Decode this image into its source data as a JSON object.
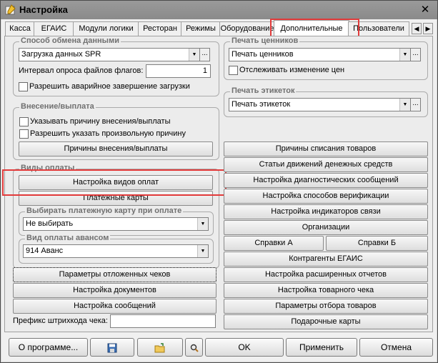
{
  "window": {
    "title": "Настройка",
    "close_glyph": "✕"
  },
  "tabs": [
    "Касса",
    "ЕГАИС",
    "Модули логики",
    "Ресторан",
    "Режимы",
    "Оборудование",
    "Дополнительные",
    "Пользователи"
  ],
  "tab_scroll": {
    "left": "◀",
    "right": "▶"
  },
  "exchange": {
    "legend": "Способ обмена данными",
    "mode_value": "Загрузка данных SPR",
    "interval_label": "Интервал опроса файлов флагов:",
    "interval_value": "1",
    "emergency_label": "Разрешить аварийное завершение загрузки"
  },
  "deposit": {
    "legend": "Внесение/выплата",
    "reason_label": "Указывать причину внесения/выплаты",
    "arbitrary_label": "Разрешить указать произвольную причину",
    "reasons_button": "Причины внесения/выплаты"
  },
  "payment_types": {
    "legend": "Виды оплаты",
    "setup_button": "Настройка видов оплат",
    "cards_button": "Платежные карты"
  },
  "select_card": {
    "legend": "Выбирать платежную карту при оплате",
    "value": "Не выбирать"
  },
  "advance": {
    "legend": "Вид оплаты авансом",
    "value": "914 Аванс"
  },
  "left_buttons": [
    "Параметры отложенных чеков",
    "Настройка документов",
    "Настройка сообщений"
  ],
  "barcode": {
    "label": "Префикс штрихкода чека:",
    "value": ""
  },
  "price_tags": {
    "legend": "Печать ценников",
    "value": "Печать ценников",
    "track_label": "Отслеживать изменение цен"
  },
  "labels_print": {
    "legend": "Печать этикеток",
    "value": "Печать этикеток"
  },
  "right_buttons": {
    "write_off": "Причины списания товаров",
    "cash_flow": "Статьи движений денежных средств",
    "diagnostics": "Настройка диагностических сообщений",
    "verification": "Настройка способов верификации",
    "connection": "Настройка индикаторов связи",
    "organizations": "Организации",
    "ref_a": "Справки А",
    "ref_b": "Справки Б",
    "egais_partners": "Контрагенты ЕГАИС",
    "ext_reports": "Настройка расширенных отчетов",
    "goods_check": "Настройка товарного чека",
    "goods_filter": "Параметры отбора товаров",
    "gift_cards": "Подарочные карты"
  },
  "ellipsis": "...",
  "bottom": {
    "about": "О программе...",
    "ok": "OK",
    "apply": "Применить",
    "cancel": "Отмена"
  },
  "colors": {
    "highlight": "#e23b3b",
    "window_bg": "#f0f0f0",
    "title_bar": "#8f8f8f"
  }
}
